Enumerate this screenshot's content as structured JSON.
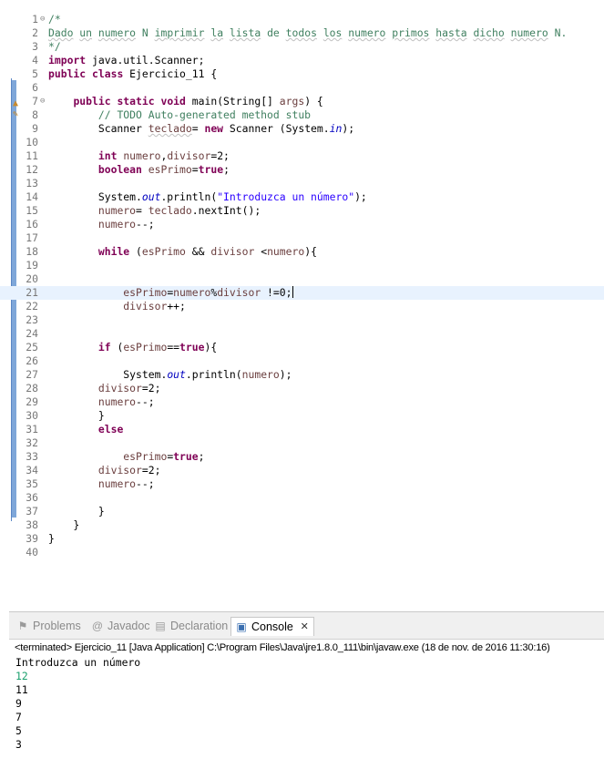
{
  "editor": {
    "lines": [
      {
        "n": "1",
        "fold": "⊖",
        "html": "<span class=\"cm\">/*</span>"
      },
      {
        "n": "2",
        "html": "<span class=\"cm\"><span class=\"spell\">Dado</span> <span class=\"spell\">un</span> <span class=\"spell\">numero</span> N <span class=\"spell\">imprimir</span> <span class=\"spell\">la</span> <span class=\"spell\">lista</span> de <span class=\"spell\">todos</span> <span class=\"spell\">los</span> <span class=\"spell\">numero</span> <span class=\"spell\">primos</span> <span class=\"spell\">hasta</span> <span class=\"spell\">dicho</span> <span class=\"spell\">numero</span> N.</span>"
      },
      {
        "n": "3",
        "html": "<span class=\"cm\">*/</span>"
      },
      {
        "n": "4",
        "html": "<span class=\"kw\">import</span> java.util.Scanner;"
      },
      {
        "n": "5",
        "html": "<span class=\"kw\">public</span> <span class=\"kw\">class</span> Ejercicio_11 {"
      },
      {
        "n": "6",
        "html": ""
      },
      {
        "n": "7",
        "fold": "⊖",
        "html": "    <span class=\"kw\">public</span> <span class=\"kw\">static</span> <span class=\"kw\">void</span> main(String[] <span class=\"var\">args</span>) {"
      },
      {
        "n": "8",
        "html": "        <span class=\"cm\">// TODO Auto-generated method stub</span>"
      },
      {
        "n": "9",
        "html": "        Scanner <span class=\"var spell\">teclado</span>= <span class=\"kw\">new</span> Scanner (System.<span class=\"fld\">in</span>);"
      },
      {
        "n": "10",
        "html": ""
      },
      {
        "n": "11",
        "html": "        <span class=\"kw\">int</span> <span class=\"var\">numero</span>,<span class=\"var\">divisor</span>=2;"
      },
      {
        "n": "12",
        "html": "        <span class=\"kw\">boolean</span> <span class=\"var\">esPrimo</span>=<span class=\"kw\">true</span>;"
      },
      {
        "n": "13",
        "html": ""
      },
      {
        "n": "14",
        "html": "        System.<span class=\"fld\">out</span>.println(<span class=\"str\">\"Introduzca un número\"</span>);"
      },
      {
        "n": "15",
        "html": "        <span class=\"var\">numero</span>= <span class=\"var\">teclado</span>.nextInt();"
      },
      {
        "n": "16",
        "html": "        <span class=\"var\">numero</span>--;"
      },
      {
        "n": "17",
        "html": ""
      },
      {
        "n": "18",
        "html": "        <span class=\"kw\">while</span> (<span class=\"var\">esPrimo</span> &amp;&amp; <span class=\"var\">divisor</span> &lt;<span class=\"var\">numero</span>){"
      },
      {
        "n": "19",
        "html": ""
      },
      {
        "n": "20",
        "html": ""
      },
      {
        "n": "21",
        "current": true,
        "html": "            <span class=\"var\">esPrimo</span>=<span class=\"var\">numero</span>%<span class=\"var\">divisor</span> !=0;<span class=\"caret\"></span>"
      },
      {
        "n": "22",
        "html": "            <span class=\"var\">divisor</span>++;"
      },
      {
        "n": "23",
        "html": ""
      },
      {
        "n": "24",
        "html": ""
      },
      {
        "n": "25",
        "html": "        <span class=\"kw\">if</span> (<span class=\"var\">esPrimo</span>==<span class=\"kw\">true</span>){"
      },
      {
        "n": "26",
        "html": ""
      },
      {
        "n": "27",
        "html": "            System.<span class=\"fld\">out</span>.println(<span class=\"var\">numero</span>);"
      },
      {
        "n": "28",
        "html": "        <span class=\"var\">divisor</span>=2;"
      },
      {
        "n": "29",
        "html": "        <span class=\"var\">numero</span>--;"
      },
      {
        "n": "30",
        "html": "        }"
      },
      {
        "n": "31",
        "html": "        <span class=\"kw\">else</span>"
      },
      {
        "n": "32",
        "html": ""
      },
      {
        "n": "33",
        "html": "            <span class=\"var\">esPrimo</span>=<span class=\"kw\">true</span>;"
      },
      {
        "n": "34",
        "html": "        <span class=\"var\">divisor</span>=2;"
      },
      {
        "n": "35",
        "html": "        <span class=\"var\">numero</span>--;"
      },
      {
        "n": "36",
        "html": ""
      },
      {
        "n": "37",
        "html": "        }"
      },
      {
        "n": "38",
        "html": "    }"
      },
      {
        "n": "39",
        "html": "}"
      },
      {
        "n": "40",
        "html": ""
      }
    ]
  },
  "views": {
    "tabs": [
      {
        "label": "Problems",
        "icon": "problems-icon",
        "glyph": "⚑"
      },
      {
        "label": "Javadoc",
        "icon": "javadoc-icon",
        "glyph": "@"
      },
      {
        "label": "Declaration",
        "icon": "declaration-icon",
        "glyph": "▤"
      },
      {
        "label": "Console",
        "icon": "console-icon",
        "glyph": "▣",
        "active": true
      }
    ],
    "close_glyph": "✕"
  },
  "console": {
    "status": "<terminated> Ejercicio_11 [Java Application] C:\\Program Files\\Java\\jre1.8.0_111\\bin\\javaw.exe (18 de nov. de 2016 11:30:16)",
    "output": [
      {
        "text": "Introduzca un número"
      },
      {
        "text": "12",
        "input": true
      },
      {
        "text": "11"
      },
      {
        "text": "9"
      },
      {
        "text": "7"
      },
      {
        "text": "5"
      },
      {
        "text": "3"
      }
    ]
  },
  "colors": {
    "keyword": "#7f0055",
    "comment": "#3f7f5f",
    "string": "#2a00ff",
    "local_var": "#6a3e3e",
    "static_field": "#0000c0",
    "console_input": "#1aa06d",
    "current_line": "#e8f2fe"
  }
}
